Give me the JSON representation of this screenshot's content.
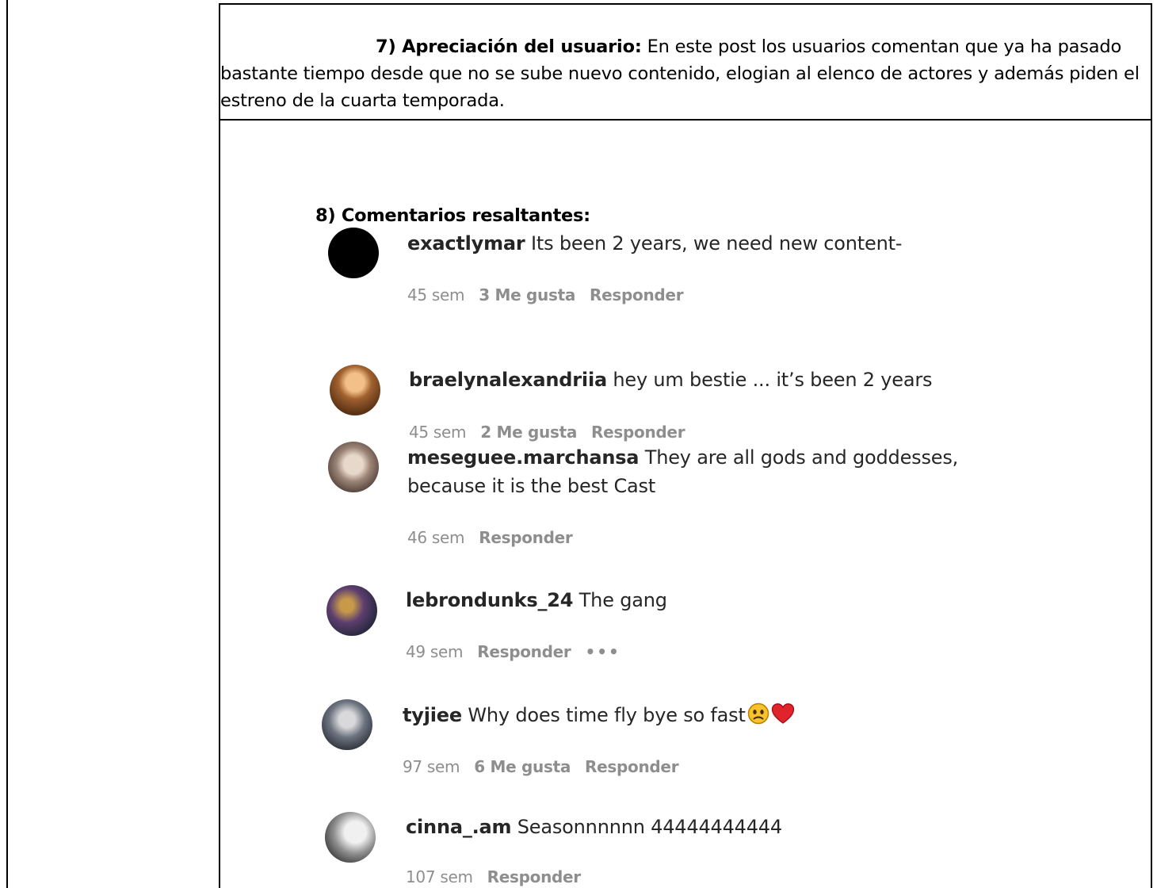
{
  "section7": {
    "heading": "7) Apreciación del usuario:",
    "text": " En este post los usuarios comentan que ya ha pasado bastante tiempo desde que no se sube nuevo contenido, elogian al elenco de actores y además piden el estreno de la cuarta temporada."
  },
  "section8": {
    "heading": "8) Comentarios resaltantes:"
  },
  "comments": [
    {
      "user": "exactlymar",
      "text": " Its been 2 years, we need new content-",
      "time": "45 sem",
      "likes": "3 Me gusta",
      "reply": "Responder"
    },
    {
      "user": "braelynalexandriia",
      "text": " hey um bestie ... it’s been 2 years",
      "time": "45 sem",
      "likes": "2 Me gusta",
      "reply": "Responder"
    },
    {
      "user": "meseguee.marchansa",
      "text": " They are all gods and goddesses,",
      "text2": "because it is the best Cast",
      "time": "46 sem",
      "reply": "Responder"
    },
    {
      "user": "lebrondunks_24",
      "text": " The gang",
      "time": "49 sem",
      "reply": "Responder",
      "more": "•••"
    },
    {
      "user": "tyjiee",
      "text": " Why does time fly bye so fast",
      "time": "97 sem",
      "likes": "6 Me gusta",
      "reply": "Responder"
    },
    {
      "user": "cinna_.am",
      "text": " Seasonnnnnn 44444444444",
      "time": "107 sem",
      "reply": "Responder"
    }
  ],
  "icons": {
    "emoji_sad": "sad-face-emoji",
    "emoji_heart": "red-heart-emoji"
  }
}
